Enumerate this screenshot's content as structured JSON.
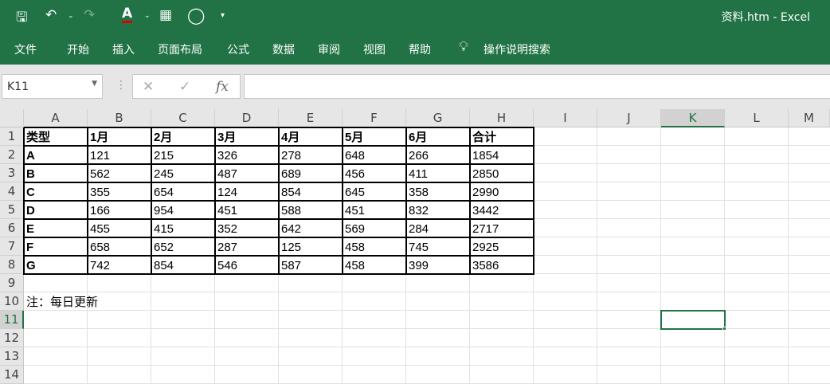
{
  "title": "资料.htm  -  Excel",
  "quick_access": {
    "save": "save-icon",
    "undo": "undo-icon",
    "redo": "redo-icon",
    "font_color": "A",
    "font_color_swatch": "#e00000"
  },
  "ribbon_tabs": [
    "文件",
    "开始",
    "插入",
    "页面布局",
    "公式",
    "数据",
    "审阅",
    "视图",
    "帮助"
  ],
  "tell_me": "操作说明搜索",
  "name_box": "K11",
  "formula_value": "",
  "fx_label": "fx",
  "columns": [
    "A",
    "B",
    "C",
    "D",
    "E",
    "F",
    "G",
    "H",
    "I",
    "J",
    "K",
    "L",
    "M"
  ],
  "rows": [
    "1",
    "2",
    "3",
    "4",
    "5",
    "6",
    "7",
    "8",
    "9",
    "10",
    "11",
    "12",
    "13",
    "14"
  ],
  "table": {
    "headers": [
      "类型",
      "1月",
      "2月",
      "3月",
      "4月",
      "5月",
      "6月",
      "合计"
    ],
    "rows": [
      [
        "A",
        "121",
        "215",
        "326",
        "278",
        "648",
        "266",
        "1854"
      ],
      [
        "B",
        "562",
        "245",
        "487",
        "689",
        "456",
        "411",
        "2850"
      ],
      [
        "C",
        "355",
        "654",
        "124",
        "854",
        "645",
        "358",
        "2990"
      ],
      [
        "D",
        "166",
        "954",
        "451",
        "588",
        "451",
        "832",
        "3442"
      ],
      [
        "E",
        "455",
        "415",
        "352",
        "642",
        "569",
        "284",
        "2717"
      ],
      [
        "F",
        "658",
        "652",
        "287",
        "125",
        "458",
        "745",
        "2925"
      ],
      [
        "G",
        "742",
        "854",
        "546",
        "587",
        "458",
        "399",
        "3586"
      ]
    ]
  },
  "note": "注：每日更新",
  "selected_cell": "K11",
  "accent": "#217346"
}
